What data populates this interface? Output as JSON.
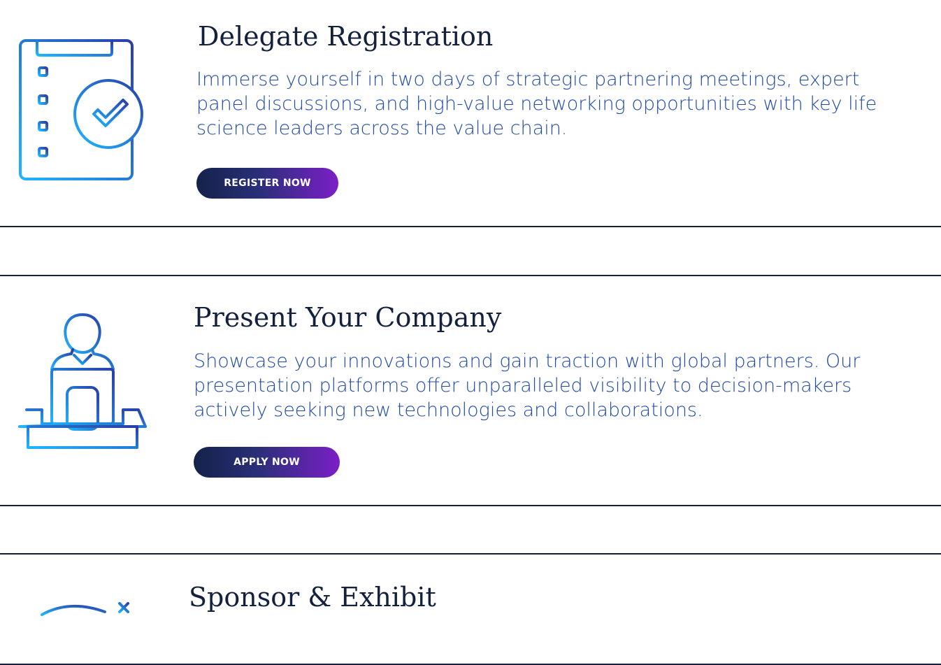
{
  "sections": [
    {
      "title": "Delegate Registration",
      "description_lines": [
        "Immerse yourself in two days of strategic partnering meetings, expert",
        "panel discussions, and high-value networking opportunities with key life",
        "science leaders across the value chain."
      ],
      "button_label": "REGISTER NOW",
      "icon": "checklist-clipboard-icon"
    },
    {
      "title": "Present Your Company",
      "description_lines": [
        "Showcase your innovations and gain traction with global partners. Our",
        "presentation platforms offer unparalleled visibility to decision-makers",
        "actively seeking new technologies and collaborations."
      ],
      "button_label": "APPLY NOW",
      "icon": "presenter-podium-icon"
    },
    {
      "title": "Sponsor & Exhibit",
      "icon": "sponsor-badge-icon"
    }
  ],
  "colors": {
    "card_border": "#14213d",
    "title": "#14213d",
    "description": "#1f4aa8",
    "button_start": "#14224a",
    "button_end": "#7b1fc7",
    "icon_start": "#1fb6ff",
    "icon_end": "#2a3fa8"
  }
}
